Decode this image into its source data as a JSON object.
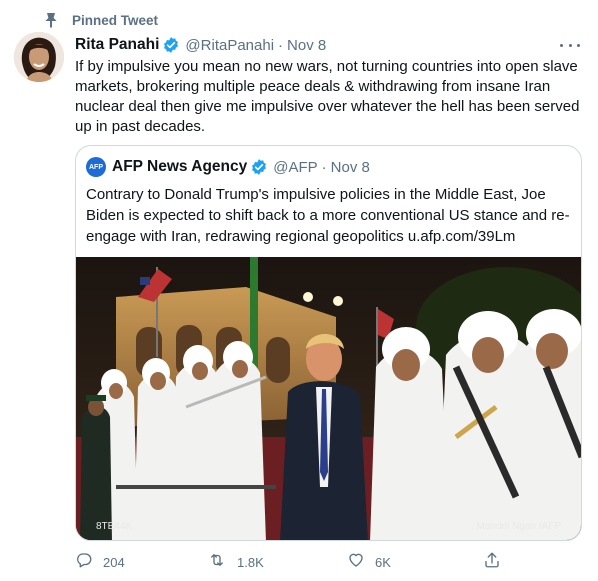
{
  "pinned": {
    "label": "Pinned Tweet",
    "icon": "pin-icon"
  },
  "tweet": {
    "author_name": "Rita Panahi",
    "handle": "@RitaPanahi",
    "separator": "·",
    "date": "Nov 8",
    "text": "If by impulsive you mean no new wars, not turning countries into open slave markets, brokering multiple peace deals & withdrawing from insane Iran nuclear deal then give me impulsive over whatever the hell has been served up in past decades."
  },
  "quote": {
    "logo_text": "AFP",
    "author_name": "AFP News Agency",
    "handle": "@AFP",
    "separator": "·",
    "date": "Nov 8",
    "text": "Contrary to Donald Trump's impulsive policies in the Middle East, Joe Biden is expected to shift back to a more conventional US stance and re-engage with Iran, redrawing regional geopolitics u.afp.com/39Lm",
    "photo_credit_left": "8TE44K",
    "photo_credit_right": "Mandel Ngan /AFP"
  },
  "actions": {
    "reply_count": "204",
    "retweet_count": "1.8K",
    "like_count": "6K",
    "share_icon": "share-icon"
  },
  "colors": {
    "accent": "#1da1f2",
    "muted": "#5b7083",
    "border": "#cfd9de"
  }
}
